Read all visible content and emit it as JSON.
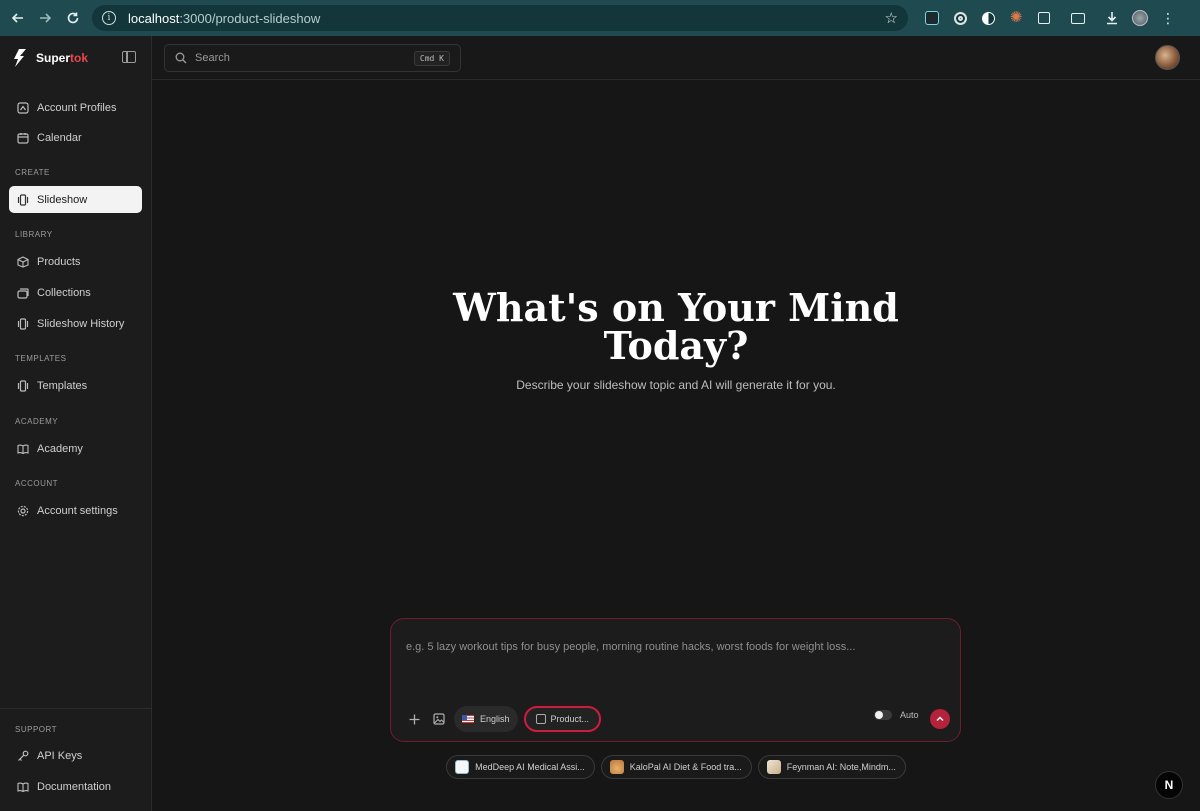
{
  "browser": {
    "url_host": "localhost",
    "url_path": ":3000/product-slideshow"
  },
  "brand": {
    "name_main": "Super",
    "name_accent": "tok",
    "accent_color": "#e5484d"
  },
  "search": {
    "placeholder": "Search",
    "shortcut": "Cmd K"
  },
  "sidebar": {
    "top_items": [
      {
        "label": "Account Profiles",
        "icon": "profile-icon"
      },
      {
        "label": "Calendar",
        "icon": "calendar-icon"
      }
    ],
    "sections": [
      {
        "title": "CREATE",
        "items": [
          {
            "label": "Slideshow",
            "icon": "slideshow-icon",
            "active": true
          }
        ]
      },
      {
        "title": "LIBRARY",
        "items": [
          {
            "label": "Products",
            "icon": "box-icon"
          },
          {
            "label": "Collections",
            "icon": "collections-icon"
          },
          {
            "label": "Slideshow History",
            "icon": "slideshow-icon"
          }
        ]
      },
      {
        "title": "TEMPLATES",
        "items": [
          {
            "label": "Templates",
            "icon": "slideshow-icon"
          }
        ]
      },
      {
        "title": "ACADEMY",
        "items": [
          {
            "label": "Academy",
            "icon": "book-icon"
          }
        ]
      },
      {
        "title": "ACCOUNT",
        "items": [
          {
            "label": "Account settings",
            "icon": "gear-icon"
          }
        ]
      },
      {
        "title": "SUPPORT",
        "items": [
          {
            "label": "API Keys",
            "icon": "key-icon"
          },
          {
            "label": "Documentation",
            "icon": "book-icon"
          }
        ]
      }
    ]
  },
  "hero": {
    "title_line1": "What's on Your Mind",
    "title_line2": "Today?",
    "subtitle": "Describe your slideshow topic and AI will generate it for you."
  },
  "composer": {
    "placeholder": "e.g. 5 lazy workout tips for busy people, morning routine hacks, worst foods for weight loss...",
    "language": "English",
    "product_label": "Product...",
    "auto_label": "Auto",
    "auto_enabled": false,
    "send_color": "#b5223c"
  },
  "suggestions": [
    {
      "label": "MedDeep AI Medical Assi...",
      "icon": "meddeep-app-icon"
    },
    {
      "label": "KaloPal AI Diet & Food tra...",
      "icon": "kalopal-app-icon"
    },
    {
      "label": "Feynman AI: Note,Mindm...",
      "icon": "feynman-app-icon"
    }
  ],
  "dev_badge": "N"
}
